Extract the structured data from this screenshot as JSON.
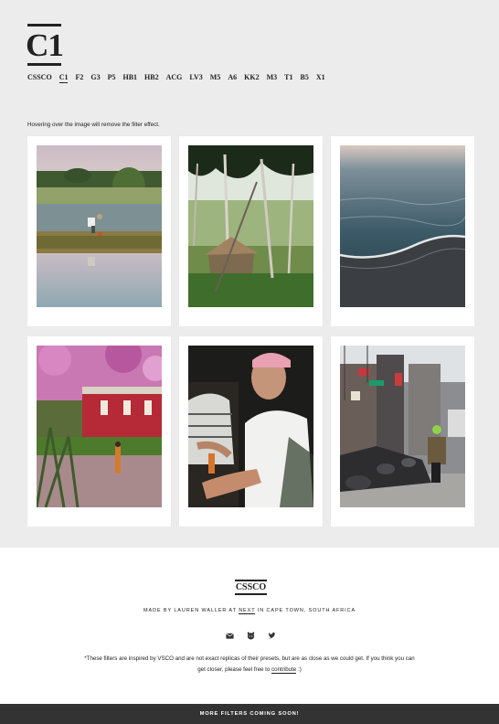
{
  "logo": {
    "text": "C1"
  },
  "nav": {
    "items": [
      {
        "label": "CSSCO",
        "active": false
      },
      {
        "label": "C1",
        "active": true
      },
      {
        "label": "F2",
        "active": false
      },
      {
        "label": "G3",
        "active": false
      },
      {
        "label": "P5",
        "active": false
      },
      {
        "label": "HB1",
        "active": false
      },
      {
        "label": "HB2",
        "active": false
      },
      {
        "label": "ACG",
        "active": false
      },
      {
        "label": "LV3",
        "active": false
      },
      {
        "label": "M5",
        "active": false
      },
      {
        "label": "A6",
        "active": false
      },
      {
        "label": "KK2",
        "active": false
      },
      {
        "label": "M3",
        "active": false
      },
      {
        "label": "T1",
        "active": false
      },
      {
        "label": "B5",
        "active": false
      },
      {
        "label": "X1",
        "active": false
      }
    ]
  },
  "hint": "Hovering over the image will remove the filter effect.",
  "footer": {
    "logo": "CSSCO",
    "made_prefix": "Made by Lauren Waller at ",
    "made_link": "NEXT",
    "made_suffix": " in Cape Town, South Africa",
    "icons": [
      "email-icon",
      "github-icon",
      "twitter-icon"
    ],
    "disclaimer": "*These filters are inspired by VSCO and are not exact replicas of their presets, but are as close as we could get. If you think you can get closer, please feel free to ",
    "disclaimer_link": "contribute",
    "disclaimer_end": " :)"
  },
  "bottom_bar": "More filters coming soon!"
}
